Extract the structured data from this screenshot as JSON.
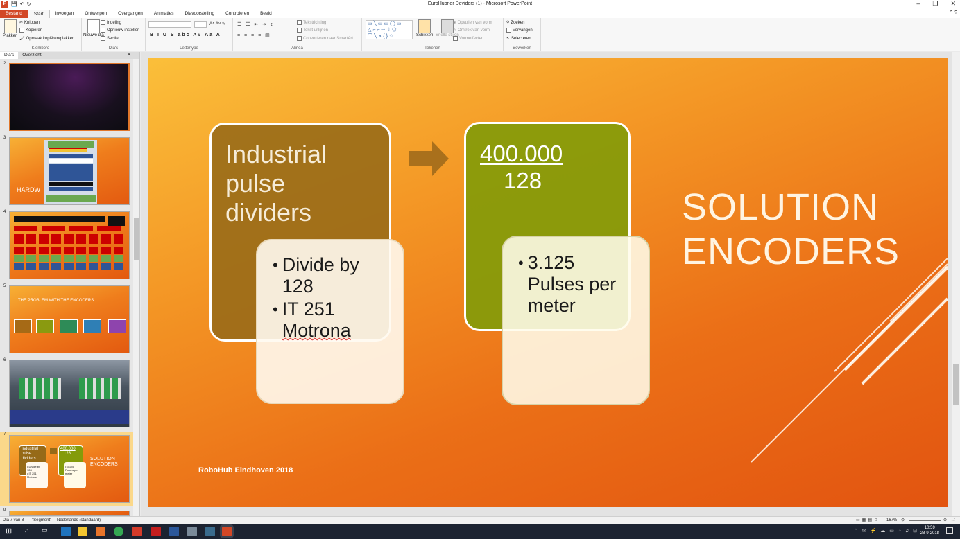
{
  "window": {
    "title": "EuroHubner Deviders (1)  -  Microsoft PowerPoint",
    "controls": [
      "–",
      "❐",
      "✕"
    ]
  },
  "ribbon_tabs": [
    "Bestand",
    "Start",
    "Invoegen",
    "Ontwerpen",
    "Overgangen",
    "Animaties",
    "Diavoorstelling",
    "Controleren",
    "Beeld"
  ],
  "ribbon": {
    "clipboard": {
      "paste": "Plakken",
      "cut": "Knippen",
      "copy": "Kopiëren",
      "format_painter": "Opmaak kopiëren/plakken",
      "label": "Klembord"
    },
    "slides": {
      "new_slide": "Nieuwe dia",
      "layout": "Indeling",
      "reset": "Opnieuw instellen",
      "section": "Sectie",
      "label": "Dia's"
    },
    "font": {
      "label": "Lettertype"
    },
    "paragraph": {
      "text_direction": "Tekstrichting",
      "align_text": "Tekst uitlijnen",
      "smartart": "Converteren naar SmartArt",
      "label": "Alinea"
    },
    "drawing": {
      "arrange": "Schikken",
      "quick_styles": "Snelle stijlen",
      "shape_fill": "Opvullen van vorm",
      "shape_outline": "Omtrek van vorm",
      "shape_effects": "Vormeffecten",
      "label": "Tekenen"
    },
    "editing": {
      "find": "Zoeken",
      "replace": "Vervangen",
      "select": "Selecteren",
      "label": "Bewerken"
    }
  },
  "pane_tabs": [
    "Dia's",
    "Overzicht"
  ],
  "thumbnails": [
    {
      "num": "2",
      "caption": ""
    },
    {
      "num": "3",
      "caption": "HARDW"
    },
    {
      "num": "4",
      "caption": ""
    },
    {
      "num": "5",
      "caption": "THE PROBLEM WITH THE ENCODERS"
    },
    {
      "num": "6",
      "caption": ""
    },
    {
      "num": "7",
      "caption": ""
    },
    {
      "num": "8",
      "caption": ""
    }
  ],
  "slide": {
    "box1_lines": [
      "Industrial",
      "pulse",
      "dividers"
    ],
    "box2_bullets": [
      [
        "Divide by",
        "128"
      ],
      [
        "IT 251",
        "Motrona"
      ]
    ],
    "fraction_numerator": "400.000",
    "fraction_denominator": "128",
    "box4_bullets": [
      [
        "3.125",
        "Pulses per",
        "meter"
      ]
    ],
    "title_lines": [
      "SOLUTION",
      "ENCODERS"
    ],
    "footer": "RoboHub Eindhoven 2018",
    "colors": {
      "box1": "#966a18",
      "box3": "#849b0a",
      "bg_top": "#fbbf3a",
      "bg_bottom": "#e25410"
    }
  },
  "thumb7": {
    "box1_lines": [
      "Industrial",
      "pulse",
      "dividers"
    ],
    "numerator": "400.000",
    "denominator": "128",
    "title_lines": [
      "SOLUTION",
      "ENCODERS"
    ],
    "bullets_a": [
      "• Divide by",
      "128",
      "• IT 251",
      "Motrona"
    ],
    "bullets_b": [
      "• 3.125",
      "Pulses per",
      "meter"
    ]
  },
  "statusbar": {
    "slide_info": "Dia 7 van 8",
    "theme": "\"Segment\"",
    "language": "Nederlands (standaard)",
    "zoom": "167%"
  },
  "taskbar": {
    "time": "10:59",
    "date": "28-9-2018"
  }
}
